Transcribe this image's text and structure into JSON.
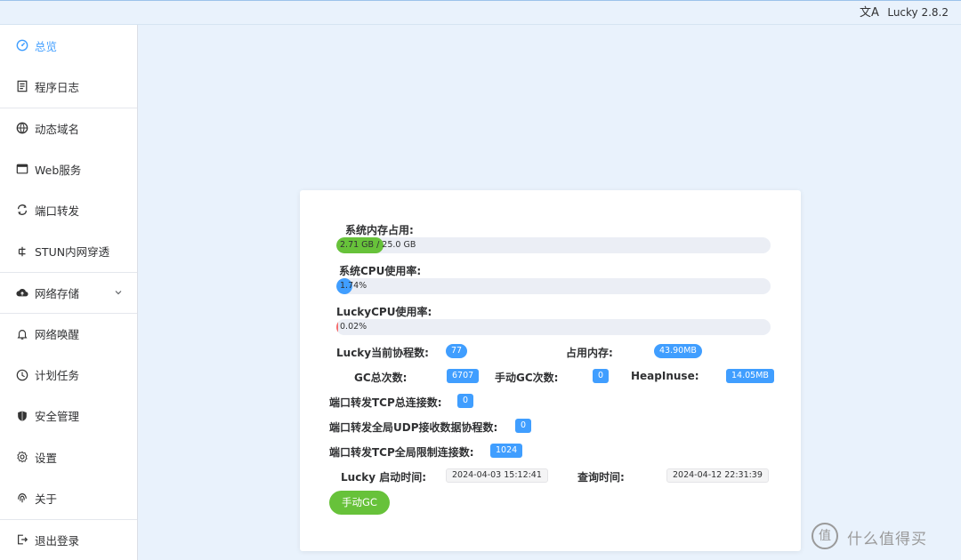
{
  "header": {
    "lang_icon": "translate-icon",
    "lang_glyph": "文A",
    "version": "Lucky 2.8.2"
  },
  "sidebar": {
    "items": [
      {
        "label": "总览",
        "icon": "dashboard-icon",
        "active": true
      },
      {
        "label": "程序日志",
        "icon": "log-icon"
      },
      {
        "label": "动态域名",
        "icon": "dns-icon"
      },
      {
        "label": "Web服务",
        "icon": "web-window-icon"
      },
      {
        "label": "端口转发",
        "icon": "port-forward-icon"
      },
      {
        "label": "STUN内网穿透",
        "icon": "stun-icon"
      },
      {
        "label": "网络存储",
        "icon": "cloud-upload-icon",
        "expandable": true
      },
      {
        "label": "网络唤醒",
        "icon": "bell-icon"
      },
      {
        "label": "计划任务",
        "icon": "clock-icon"
      },
      {
        "label": "安全管理",
        "icon": "shield-icon"
      },
      {
        "label": "设置",
        "icon": "gear-icon"
      },
      {
        "label": "关于",
        "icon": "fingerprint-icon"
      },
      {
        "label": "退出登录",
        "icon": "logout-icon"
      }
    ]
  },
  "overview": {
    "mem_label": "系统内存占用:",
    "mem_text": "2.71 GB / 25.0 GB",
    "mem_ratio": 0.108,
    "cpu_label": "系统CPU使用率:",
    "cpu_text": "1.74%",
    "cpu_ratio": 0.0174,
    "lucky_cpu_label": "LuckyCPU使用率:",
    "lucky_cpu_text": "0.02%",
    "lucky_cpu_ratio": 0.0002,
    "goroutines_label": "Lucky当前协程数:",
    "goroutines_value": "77",
    "mem_used_label": "占用内存:",
    "mem_used_value": "43.90MB",
    "gc_count_label": "GC总次数:",
    "gc_count_value": "6707",
    "manual_gc_label": "手动GC次数:",
    "manual_gc_value": "0",
    "heap_label": "HeapInuse:",
    "heap_value": "14.05MB",
    "tcp_conn_label": "端口转发TCP总连接数:",
    "tcp_conn_value": "0",
    "udp_label": "端口转发全局UDP接收数据协程数:",
    "udp_value": "0",
    "tcp_limit_label": "端口转发TCP全局限制连接数:",
    "tcp_limit_value": "1024",
    "start_time_label": "Lucky 启动时间:",
    "start_time_value": "2024-04-03 15:12:41",
    "query_time_label": "查询时间:",
    "query_time_value": "2024-04-12 22:31:39",
    "gc_button": "手动GC"
  },
  "colors": {
    "accent": "#409eff",
    "mem_bar": "#67c23a",
    "cpu_bar": "#409eff",
    "lucky_cpu_bar": "#f56c6c",
    "gc_button": "#67c23a"
  },
  "watermark": {
    "glyph": "值",
    "text": "什么值得买"
  }
}
